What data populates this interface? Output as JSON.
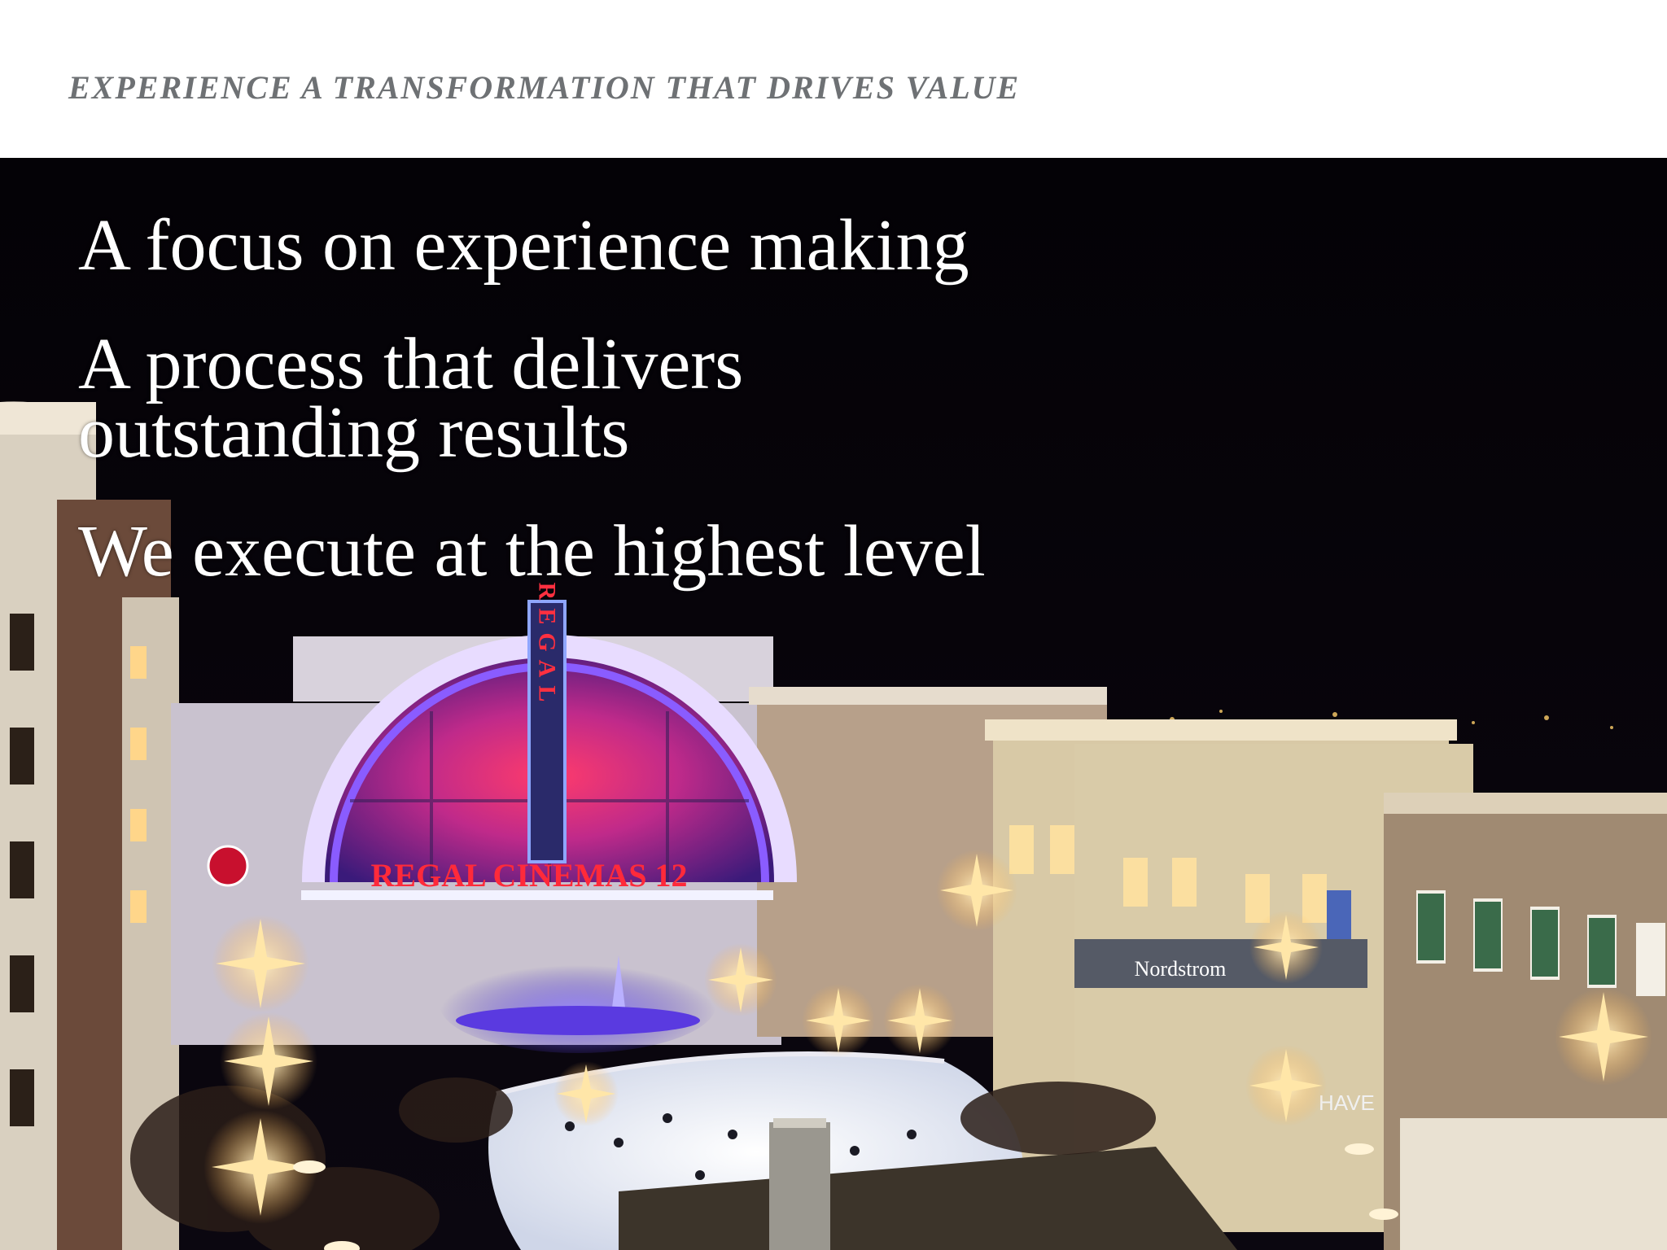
{
  "header": {
    "eyebrow": "EXPERIENCE A TRANSFORMATION THAT DRIVES VALUE"
  },
  "headlines": [
    "A focus on experience making",
    "A process that delivers outstanding results",
    "We execute at the highest level"
  ],
  "photo": {
    "signs": {
      "theater_vertical": "REGAL",
      "theater_marquee": "REGAL CINEMAS 12",
      "store_sign": "Nordstrom",
      "store_sign_2": "HAVE"
    }
  },
  "colors": {
    "eyebrow": "#6e7174",
    "headline": "#ffffff",
    "night_sky": "#050308",
    "neon_purple": "#7b3cff",
    "neon_red": "#ff2a3a",
    "lights_warm": "#ffe6a8"
  }
}
